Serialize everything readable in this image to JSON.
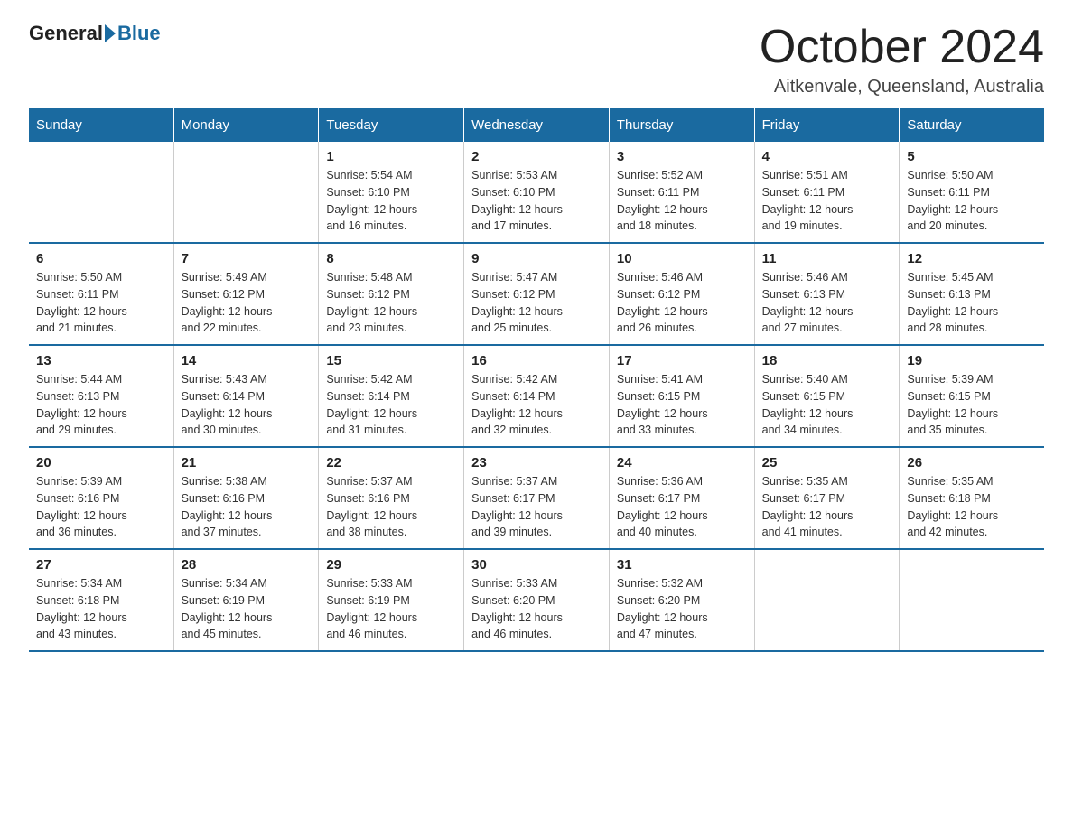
{
  "logo": {
    "text_general": "General",
    "text_blue": "Blue"
  },
  "title": "October 2024",
  "subtitle": "Aitkenvale, Queensland, Australia",
  "days_of_week": [
    "Sunday",
    "Monday",
    "Tuesday",
    "Wednesday",
    "Thursday",
    "Friday",
    "Saturday"
  ],
  "weeks": [
    [
      {
        "day": "",
        "info": ""
      },
      {
        "day": "",
        "info": ""
      },
      {
        "day": "1",
        "info": "Sunrise: 5:54 AM\nSunset: 6:10 PM\nDaylight: 12 hours\nand 16 minutes."
      },
      {
        "day": "2",
        "info": "Sunrise: 5:53 AM\nSunset: 6:10 PM\nDaylight: 12 hours\nand 17 minutes."
      },
      {
        "day": "3",
        "info": "Sunrise: 5:52 AM\nSunset: 6:11 PM\nDaylight: 12 hours\nand 18 minutes."
      },
      {
        "day": "4",
        "info": "Sunrise: 5:51 AM\nSunset: 6:11 PM\nDaylight: 12 hours\nand 19 minutes."
      },
      {
        "day": "5",
        "info": "Sunrise: 5:50 AM\nSunset: 6:11 PM\nDaylight: 12 hours\nand 20 minutes."
      }
    ],
    [
      {
        "day": "6",
        "info": "Sunrise: 5:50 AM\nSunset: 6:11 PM\nDaylight: 12 hours\nand 21 minutes."
      },
      {
        "day": "7",
        "info": "Sunrise: 5:49 AM\nSunset: 6:12 PM\nDaylight: 12 hours\nand 22 minutes."
      },
      {
        "day": "8",
        "info": "Sunrise: 5:48 AM\nSunset: 6:12 PM\nDaylight: 12 hours\nand 23 minutes."
      },
      {
        "day": "9",
        "info": "Sunrise: 5:47 AM\nSunset: 6:12 PM\nDaylight: 12 hours\nand 25 minutes."
      },
      {
        "day": "10",
        "info": "Sunrise: 5:46 AM\nSunset: 6:12 PM\nDaylight: 12 hours\nand 26 minutes."
      },
      {
        "day": "11",
        "info": "Sunrise: 5:46 AM\nSunset: 6:13 PM\nDaylight: 12 hours\nand 27 minutes."
      },
      {
        "day": "12",
        "info": "Sunrise: 5:45 AM\nSunset: 6:13 PM\nDaylight: 12 hours\nand 28 minutes."
      }
    ],
    [
      {
        "day": "13",
        "info": "Sunrise: 5:44 AM\nSunset: 6:13 PM\nDaylight: 12 hours\nand 29 minutes."
      },
      {
        "day": "14",
        "info": "Sunrise: 5:43 AM\nSunset: 6:14 PM\nDaylight: 12 hours\nand 30 minutes."
      },
      {
        "day": "15",
        "info": "Sunrise: 5:42 AM\nSunset: 6:14 PM\nDaylight: 12 hours\nand 31 minutes."
      },
      {
        "day": "16",
        "info": "Sunrise: 5:42 AM\nSunset: 6:14 PM\nDaylight: 12 hours\nand 32 minutes."
      },
      {
        "day": "17",
        "info": "Sunrise: 5:41 AM\nSunset: 6:15 PM\nDaylight: 12 hours\nand 33 minutes."
      },
      {
        "day": "18",
        "info": "Sunrise: 5:40 AM\nSunset: 6:15 PM\nDaylight: 12 hours\nand 34 minutes."
      },
      {
        "day": "19",
        "info": "Sunrise: 5:39 AM\nSunset: 6:15 PM\nDaylight: 12 hours\nand 35 minutes."
      }
    ],
    [
      {
        "day": "20",
        "info": "Sunrise: 5:39 AM\nSunset: 6:16 PM\nDaylight: 12 hours\nand 36 minutes."
      },
      {
        "day": "21",
        "info": "Sunrise: 5:38 AM\nSunset: 6:16 PM\nDaylight: 12 hours\nand 37 minutes."
      },
      {
        "day": "22",
        "info": "Sunrise: 5:37 AM\nSunset: 6:16 PM\nDaylight: 12 hours\nand 38 minutes."
      },
      {
        "day": "23",
        "info": "Sunrise: 5:37 AM\nSunset: 6:17 PM\nDaylight: 12 hours\nand 39 minutes."
      },
      {
        "day": "24",
        "info": "Sunrise: 5:36 AM\nSunset: 6:17 PM\nDaylight: 12 hours\nand 40 minutes."
      },
      {
        "day": "25",
        "info": "Sunrise: 5:35 AM\nSunset: 6:17 PM\nDaylight: 12 hours\nand 41 minutes."
      },
      {
        "day": "26",
        "info": "Sunrise: 5:35 AM\nSunset: 6:18 PM\nDaylight: 12 hours\nand 42 minutes."
      }
    ],
    [
      {
        "day": "27",
        "info": "Sunrise: 5:34 AM\nSunset: 6:18 PM\nDaylight: 12 hours\nand 43 minutes."
      },
      {
        "day": "28",
        "info": "Sunrise: 5:34 AM\nSunset: 6:19 PM\nDaylight: 12 hours\nand 45 minutes."
      },
      {
        "day": "29",
        "info": "Sunrise: 5:33 AM\nSunset: 6:19 PM\nDaylight: 12 hours\nand 46 minutes."
      },
      {
        "day": "30",
        "info": "Sunrise: 5:33 AM\nSunset: 6:20 PM\nDaylight: 12 hours\nand 46 minutes."
      },
      {
        "day": "31",
        "info": "Sunrise: 5:32 AM\nSunset: 6:20 PM\nDaylight: 12 hours\nand 47 minutes."
      },
      {
        "day": "",
        "info": ""
      },
      {
        "day": "",
        "info": ""
      }
    ]
  ]
}
